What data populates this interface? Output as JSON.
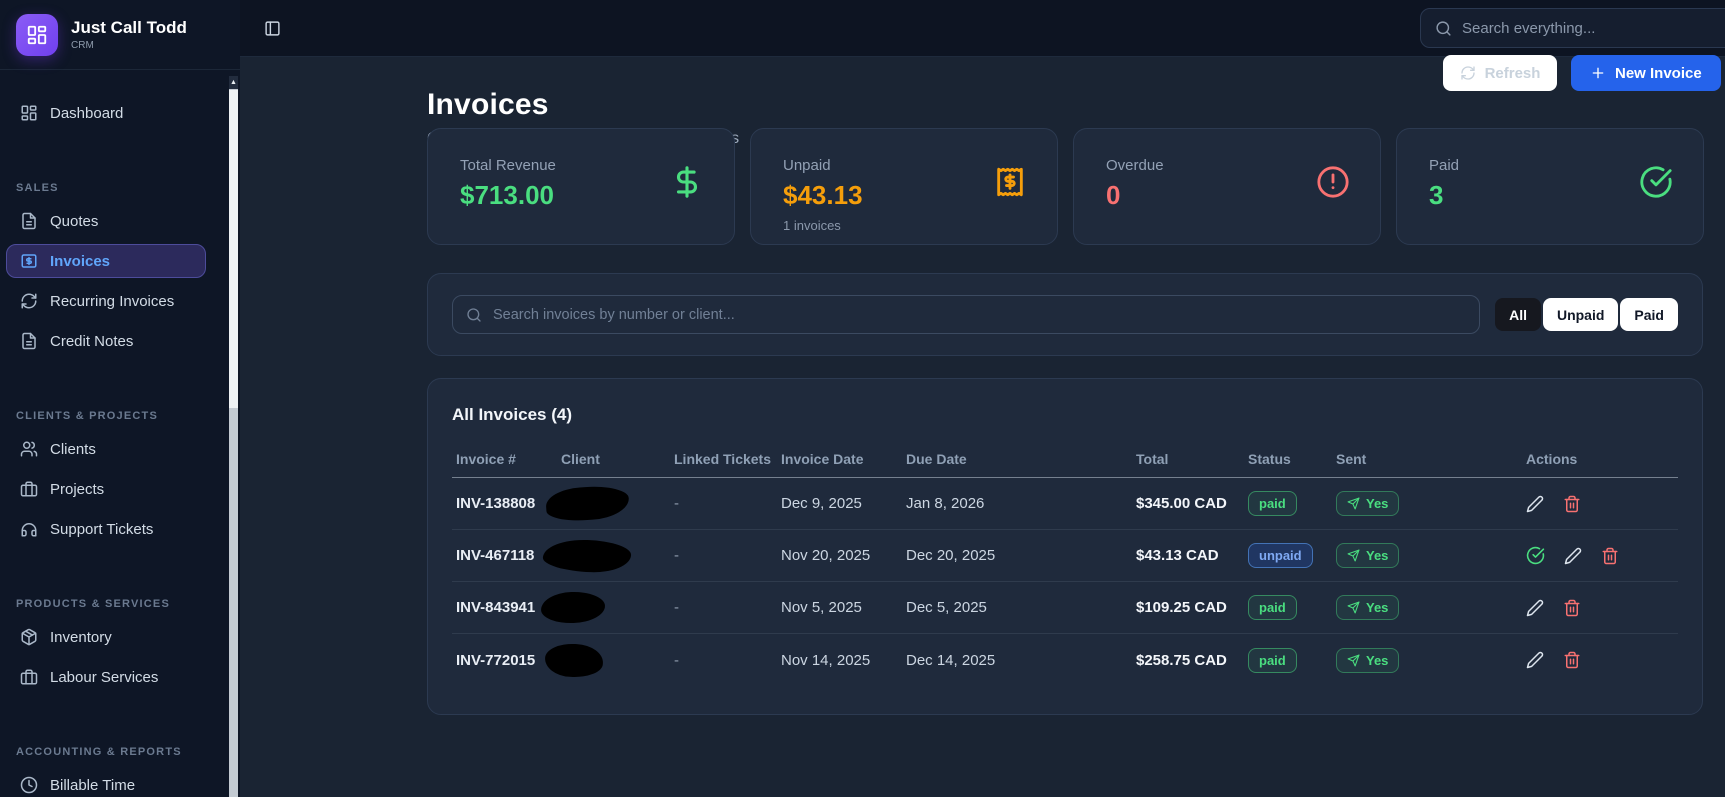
{
  "brand": {
    "name": "Just Call Todd",
    "subtitle": "CRM",
    "logo_icon": "grid-icon"
  },
  "topbar": {
    "toggle_icon": "panel-left-icon",
    "search_icon": "search-icon",
    "search_placeholder": "Search everything...",
    "search_value": ""
  },
  "sidebar": {
    "sections": [
      {
        "label": "",
        "items": [
          {
            "label": "Dashboard",
            "icon": "grid-icon",
            "active": false
          }
        ]
      },
      {
        "label": "SALES",
        "items": [
          {
            "label": "Quotes",
            "icon": "file-icon",
            "active": false
          },
          {
            "label": "Invoices",
            "icon": "invoice-dollar-icon",
            "active": true
          },
          {
            "label": "Recurring Invoices",
            "icon": "refresh-icon",
            "active": false
          },
          {
            "label": "Credit Notes",
            "icon": "file-icon",
            "active": false
          }
        ]
      },
      {
        "label": "CLIENTS & PROJECTS",
        "items": [
          {
            "label": "Clients",
            "icon": "users-icon",
            "active": false
          },
          {
            "label": "Projects",
            "icon": "briefcase-icon",
            "active": false
          },
          {
            "label": "Support Tickets",
            "icon": "headphones-icon",
            "active": false
          }
        ]
      },
      {
        "label": "PRODUCTS & SERVICES",
        "items": [
          {
            "label": "Inventory",
            "icon": "package-icon",
            "active": false
          },
          {
            "label": "Labour Services",
            "icon": "briefcase-icon",
            "active": false
          }
        ]
      },
      {
        "label": "ACCOUNTING & REPORTS",
        "items": [
          {
            "label": "Billable Time",
            "icon": "clock-icon",
            "active": false
          }
        ]
      }
    ]
  },
  "header": {
    "title": "Invoices",
    "subtitle": "Create and manage invoices for your clients",
    "refresh_label": "Refresh",
    "new_invoice_label": "New Invoice"
  },
  "stats": {
    "cards": [
      {
        "label": "Total Revenue",
        "value": "$713.00",
        "sub": "",
        "color": "#4ade80",
        "icon": "dollar-icon"
      },
      {
        "label": "Unpaid",
        "value": "$43.13",
        "sub": "1 invoices",
        "color": "#f59e0b",
        "icon": "receipt-icon"
      },
      {
        "label": "Overdue",
        "value": "0",
        "sub": "",
        "color": "#f87171",
        "icon": "alert-circle-icon"
      },
      {
        "label": "Paid",
        "value": "3",
        "sub": "",
        "color": "#4ade80",
        "icon": "check-circle-icon"
      }
    ]
  },
  "filters": {
    "search_placeholder": "Search invoices by number or client...",
    "search_value": "",
    "options": [
      {
        "label": "All",
        "active": true
      },
      {
        "label": "Unpaid",
        "active": false
      },
      {
        "label": "Paid",
        "active": false
      }
    ]
  },
  "table": {
    "title": "All Invoices (4)",
    "columns": [
      "Invoice #",
      "Client",
      "Linked Tickets",
      "Invoice Date",
      "Due Date",
      "Total",
      "Status",
      "Sent",
      "Actions"
    ],
    "rows": [
      {
        "invoice": "INV-138808",
        "client": "[redacted]",
        "linked": "-",
        "invoice_date": "Dec 9, 2025",
        "due_date": "Jan 8, 2026",
        "total": "$345.00 CAD",
        "status": "paid",
        "sent": "Yes",
        "actions": [
          "edit",
          "delete"
        ]
      },
      {
        "invoice": "INV-467118",
        "client": "[redacted]",
        "linked": "-",
        "invoice_date": "Nov 20, 2025",
        "due_date": "Dec 20, 2025",
        "total": "$43.13 CAD",
        "status": "unpaid",
        "sent": "Yes",
        "actions": [
          "mark-paid",
          "edit",
          "delete"
        ]
      },
      {
        "invoice": "INV-843941",
        "client": "[redacted]",
        "linked": "-",
        "invoice_date": "Nov 5, 2025",
        "due_date": "Dec 5, 2025",
        "total": "$109.25 CAD",
        "status": "paid",
        "sent": "Yes",
        "actions": [
          "edit",
          "delete"
        ]
      },
      {
        "invoice": "INV-772015",
        "client": "[redacted]",
        "linked": "-",
        "invoice_date": "Nov 14, 2025",
        "due_date": "Dec 14, 2025",
        "total": "$258.75 CAD",
        "status": "paid",
        "sent": "Yes",
        "actions": [
          "edit",
          "delete"
        ]
      }
    ]
  },
  "colors": {
    "primary_button": "#2563eb",
    "active_link": "#60a5fa",
    "green": "#4ade80",
    "orange": "#f59e0b",
    "red": "#f87171",
    "sidebar_bg": "#0e1626",
    "page_bg": "#1a2433",
    "card_bg": "#1f2a3c"
  }
}
